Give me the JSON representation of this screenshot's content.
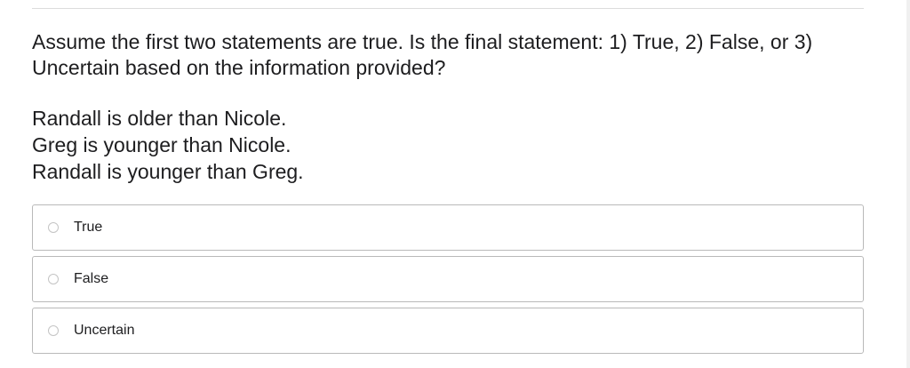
{
  "question": {
    "prompt": "Assume the first two statements are true. Is the final statement: 1) True, 2) False, or 3) Uncertain based on the information provided?",
    "statements": [
      "Randall is older than Nicole.",
      "Greg is younger than Nicole.",
      "Randall is younger than Greg."
    ]
  },
  "options": [
    {
      "label": "True"
    },
    {
      "label": "False"
    },
    {
      "label": "Uncertain"
    }
  ],
  "colors": {
    "text": "#1d1d1f",
    "border": "#b9b9b9",
    "radio_border": "#c4c4c4"
  }
}
